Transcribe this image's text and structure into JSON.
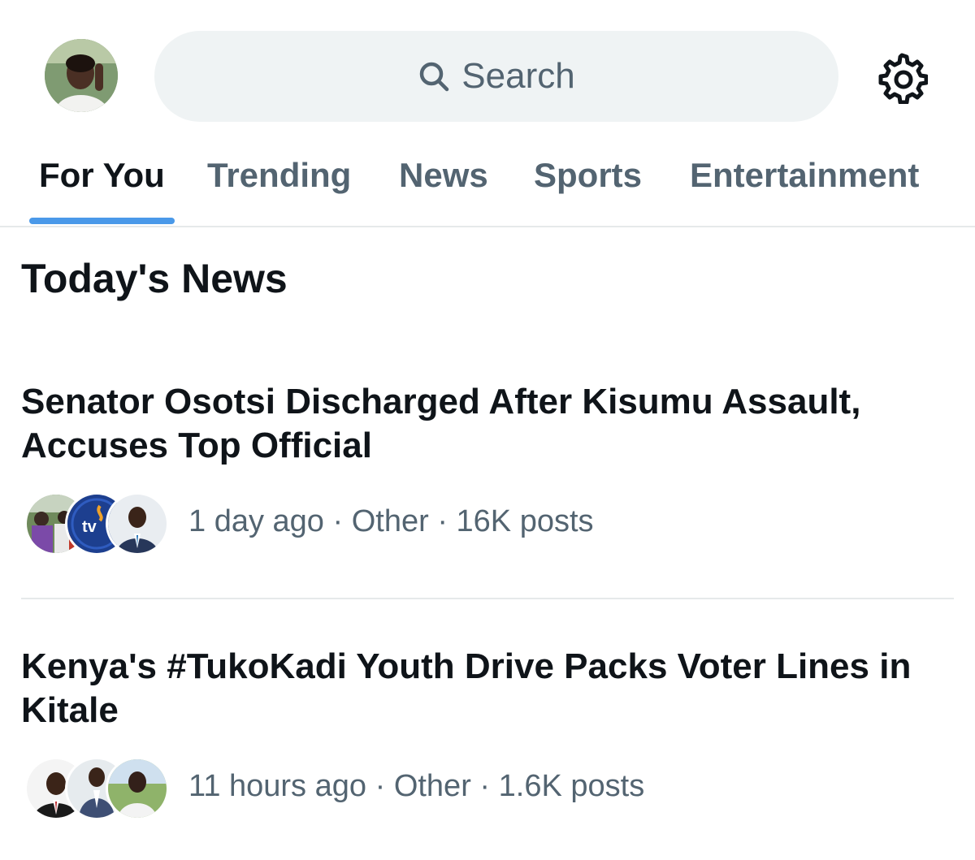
{
  "header": {
    "avatar_icon": "user-avatar",
    "search": {
      "placeholder": "Search",
      "icon": "search-icon"
    },
    "settings_icon": "gear-icon"
  },
  "tabs": [
    {
      "label": "For You",
      "active": true
    },
    {
      "label": "Trending",
      "active": false
    },
    {
      "label": "News",
      "active": false
    },
    {
      "label": "Sports",
      "active": false
    },
    {
      "label": "Entertainment",
      "active": false
    }
  ],
  "section": {
    "title": "Today's News"
  },
  "stories": [
    {
      "title": "Senator Osotsi Discharged After Kisumu Assault, Accuses Top Official",
      "time": "1 day ago",
      "category": "Other",
      "posts": "16K posts",
      "faces": [
        "crowd-photo",
        "ntv-logo",
        "person-suit-photo"
      ]
    },
    {
      "title": "Kenya's #TukoKadi Youth Drive Packs Voter Lines in Kitale",
      "time": "11 hours ago",
      "category": "Other",
      "posts": "1.6K posts",
      "faces": [
        "person-suit-photo",
        "person-suit-photo",
        "person-outdoor-photo"
      ]
    }
  ],
  "colors": {
    "accent": "#4a99e9",
    "text_primary": "#0f1419",
    "text_secondary": "#536471",
    "search_bg": "#eff3f4",
    "divider": "#e6e9ea",
    "ntv_blue": "#1d3f8f"
  },
  "separator": "·"
}
